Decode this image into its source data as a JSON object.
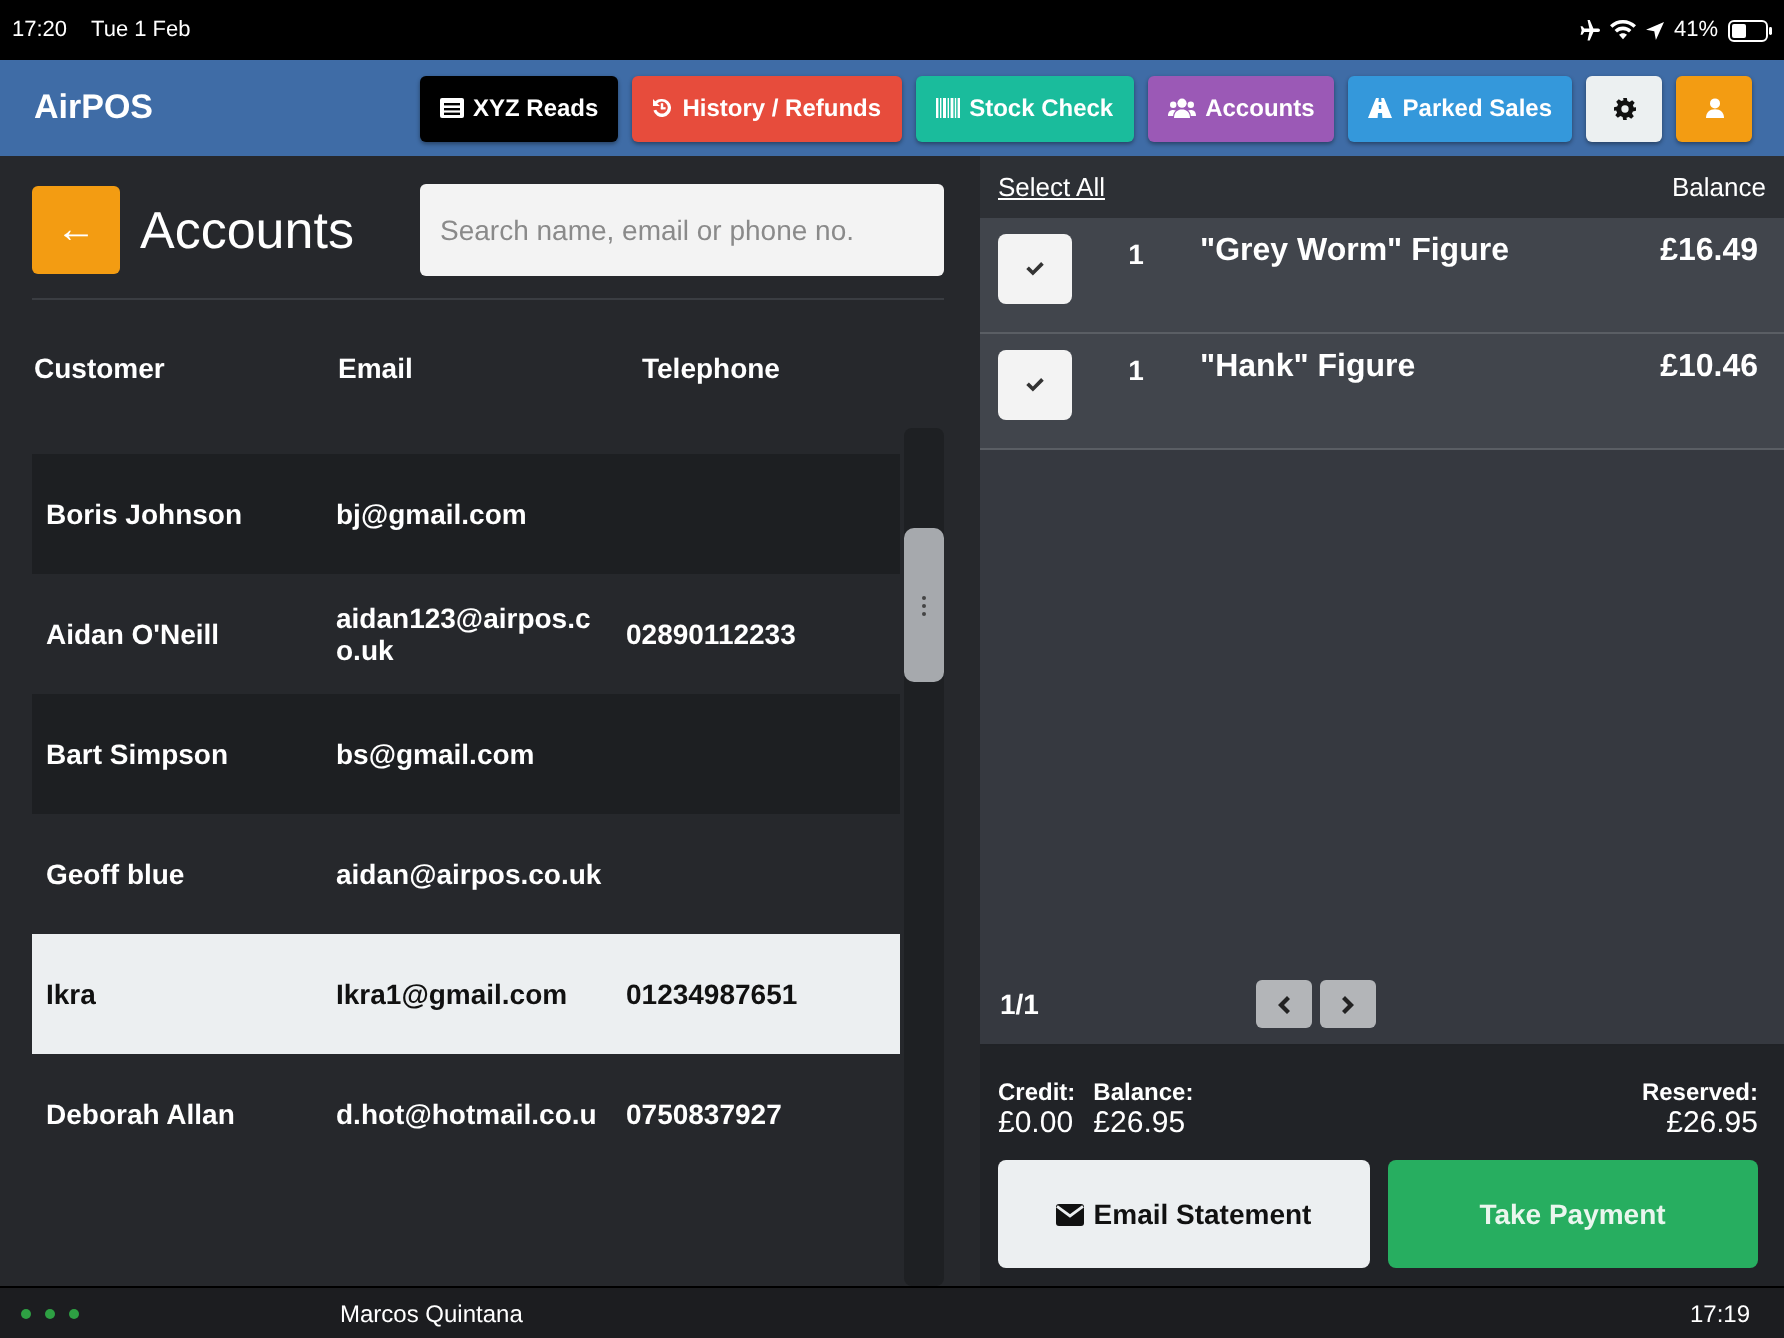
{
  "status_bar": {
    "time": "17:20",
    "date": "Tue 1 Feb",
    "battery": "41%"
  },
  "header": {
    "app_name": "AirPOS",
    "buttons": [
      {
        "kind": "reads",
        "label": "XYZ Reads",
        "color": "#000000"
      },
      {
        "kind": "history",
        "label": "History / Refunds",
        "color": "#e74c3c"
      },
      {
        "kind": "stock",
        "label": "Stock Check",
        "color": "#1abc9c"
      },
      {
        "kind": "accounts",
        "label": "Accounts",
        "color": "#9b59b6"
      },
      {
        "kind": "parked",
        "label": "Parked Sales",
        "color": "#3498db"
      },
      {
        "kind": "settings",
        "color": "#ecf0f1"
      },
      {
        "kind": "user",
        "color": "#f39c12"
      }
    ]
  },
  "accounts": {
    "title": "Accounts",
    "back_label": "←",
    "search": {
      "placeholder": "Search name, email or phone no."
    },
    "columns": [
      "Customer",
      "Email",
      "Telephone"
    ],
    "rows": [
      {
        "customer": "Boris Johnson",
        "email": "bj@gmail.com",
        "telephone": "",
        "selected": false
      },
      {
        "customer": "Aidan O'Neill",
        "email": "aidan123@airpos.co.uk",
        "telephone": "02890112233",
        "selected": false
      },
      {
        "customer": "Bart Simpson",
        "email": "bs@gmail.com",
        "telephone": "",
        "selected": false
      },
      {
        "customer": "Geoff blue",
        "email": "aidan@airpos.co.uk",
        "telephone": "",
        "selected": false
      },
      {
        "customer": "Ikra",
        "email": "Ikra1@gmail.com",
        "telephone": "01234987651",
        "selected": true
      },
      {
        "customer": "Deborah Allan",
        "email": "d.hot@hotmail.co.u",
        "telephone": "0750837927",
        "selected": false
      }
    ]
  },
  "sale": {
    "select_all": "Select All",
    "balance_heading": "Balance",
    "items": [
      {
        "checked": true,
        "qty": "1",
        "name": "\"Grey Worm\" Figure",
        "price": "£16.49"
      },
      {
        "checked": true,
        "qty": "1",
        "name": "\"Hank\" Figure",
        "price": "£10.46"
      }
    ],
    "page": "1/1",
    "totals": [
      {
        "label": "Credit:",
        "value": "£0.00"
      },
      {
        "label": "Balance:",
        "value": "£26.95"
      },
      {
        "label": "Reserved:",
        "value": "£26.95"
      }
    ],
    "buttons": [
      {
        "kind": "email",
        "label": "Email Statement"
      },
      {
        "kind": "pay",
        "label": "Take Payment"
      }
    ]
  },
  "footer": {
    "user": "Marcos Quintana",
    "time": "17:19"
  }
}
